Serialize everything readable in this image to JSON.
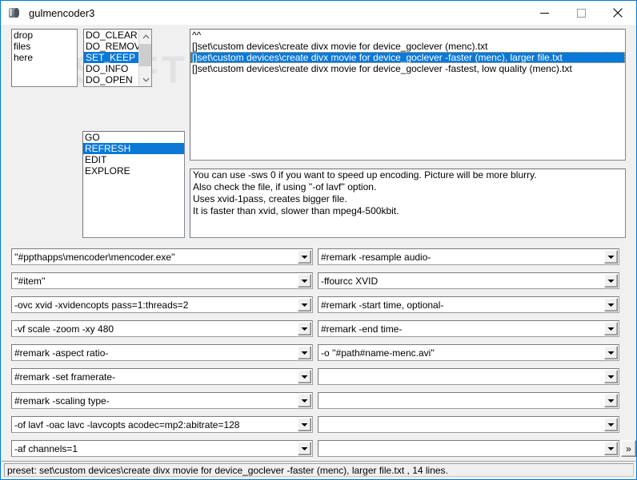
{
  "window": {
    "title": "gulmencoder3",
    "icon": "app-barrel-icon",
    "controls": {
      "minimize": "minimize-icon",
      "maximize": "maximize-icon",
      "close": "close-icon"
    },
    "watermark": "SOFTPEDIA"
  },
  "colors": {
    "selection": "#0a78d7",
    "selection_text": "#ffffff",
    "window_bg": "#f0f0f0",
    "field_bg": "#ffffff",
    "accent_border": "#0078d7"
  },
  "drop_list": {
    "items": [
      "drop",
      "files",
      "here"
    ]
  },
  "command_list": {
    "items": [
      "DO_CLEAR",
      "DO_REMOVE",
      "SET_KEEP",
      "DO_INFO",
      "DO_OPEN"
    ],
    "selected_index": 2,
    "scrollbar": {
      "up": "scroll-up-arrow-icon",
      "down": "scroll-down-arrow-icon"
    }
  },
  "action_list": {
    "items": [
      "GO",
      "REFRESH",
      "EDIT",
      "EXPLORE"
    ],
    "selected_index": 1
  },
  "preset_list": {
    "header": "^^",
    "items": [
      "[]set\\custom devices\\create divx movie  for device_goclever (menc).txt",
      "[]set\\custom devices\\create divx movie  for device_goclever -faster (menc), larger file.txt",
      "[]set\\custom devices\\create divx movie  for device_goclever -fastest, low quality (menc).txt"
    ],
    "selected_index": 1
  },
  "description": {
    "lines": [
      "You can use -sws 0 if you want to speed up encoding. Picture will be more blurry.",
      "Also check the file, if using ''-of lavf'' option.",
      "Uses xvid-1pass, creates bigger file.",
      "It is faster than xvid, slower than mpeg4-500kbit."
    ]
  },
  "params": {
    "left": [
      {
        "value": "''#ppthapps\\mencoder\\mencoder.exe''",
        "placeholder": ""
      },
      {
        "value": "''#item''",
        "placeholder": ""
      },
      {
        "value": "-ovc xvid -xvidencopts pass=1:threads=2",
        "placeholder": ""
      },
      {
        "value": "-vf scale -zoom -xy 480",
        "placeholder": ""
      },
      {
        "value": "#remark -aspect ratio-",
        "placeholder": ""
      },
      {
        "value": "#remark -set framerate-",
        "placeholder": ""
      },
      {
        "value": "#remark -scaling type-",
        "placeholder": ""
      },
      {
        "value": "-of lavf -oac lavc -lavcopts acodec=mp2:abitrate=128",
        "placeholder": ""
      },
      {
        "value": "-af channels=1",
        "placeholder": ""
      }
    ],
    "right": [
      {
        "value": "#remark -resample audio-",
        "placeholder": ""
      },
      {
        "value": "-ffourcc XVID",
        "placeholder": ""
      },
      {
        "value": "#remark -start time, optional-",
        "placeholder": ""
      },
      {
        "value": "#remark -end time-",
        "placeholder": ""
      },
      {
        "value": "-o ''#path#name-menc.avi''",
        "placeholder": ""
      },
      {
        "value": "",
        "placeholder": ""
      },
      {
        "value": "",
        "placeholder": ""
      },
      {
        "value": "",
        "placeholder": ""
      },
      {
        "value": "",
        "placeholder": ""
      }
    ],
    "dropdown_icon": "chevron-down-icon"
  },
  "more_button": {
    "label": "»",
    "name": "expand-more-button"
  },
  "statusbar": {
    "text": "preset: set\\custom devices\\create divx movie  for device_goclever -faster (menc), larger file.txt , 14 lines."
  }
}
